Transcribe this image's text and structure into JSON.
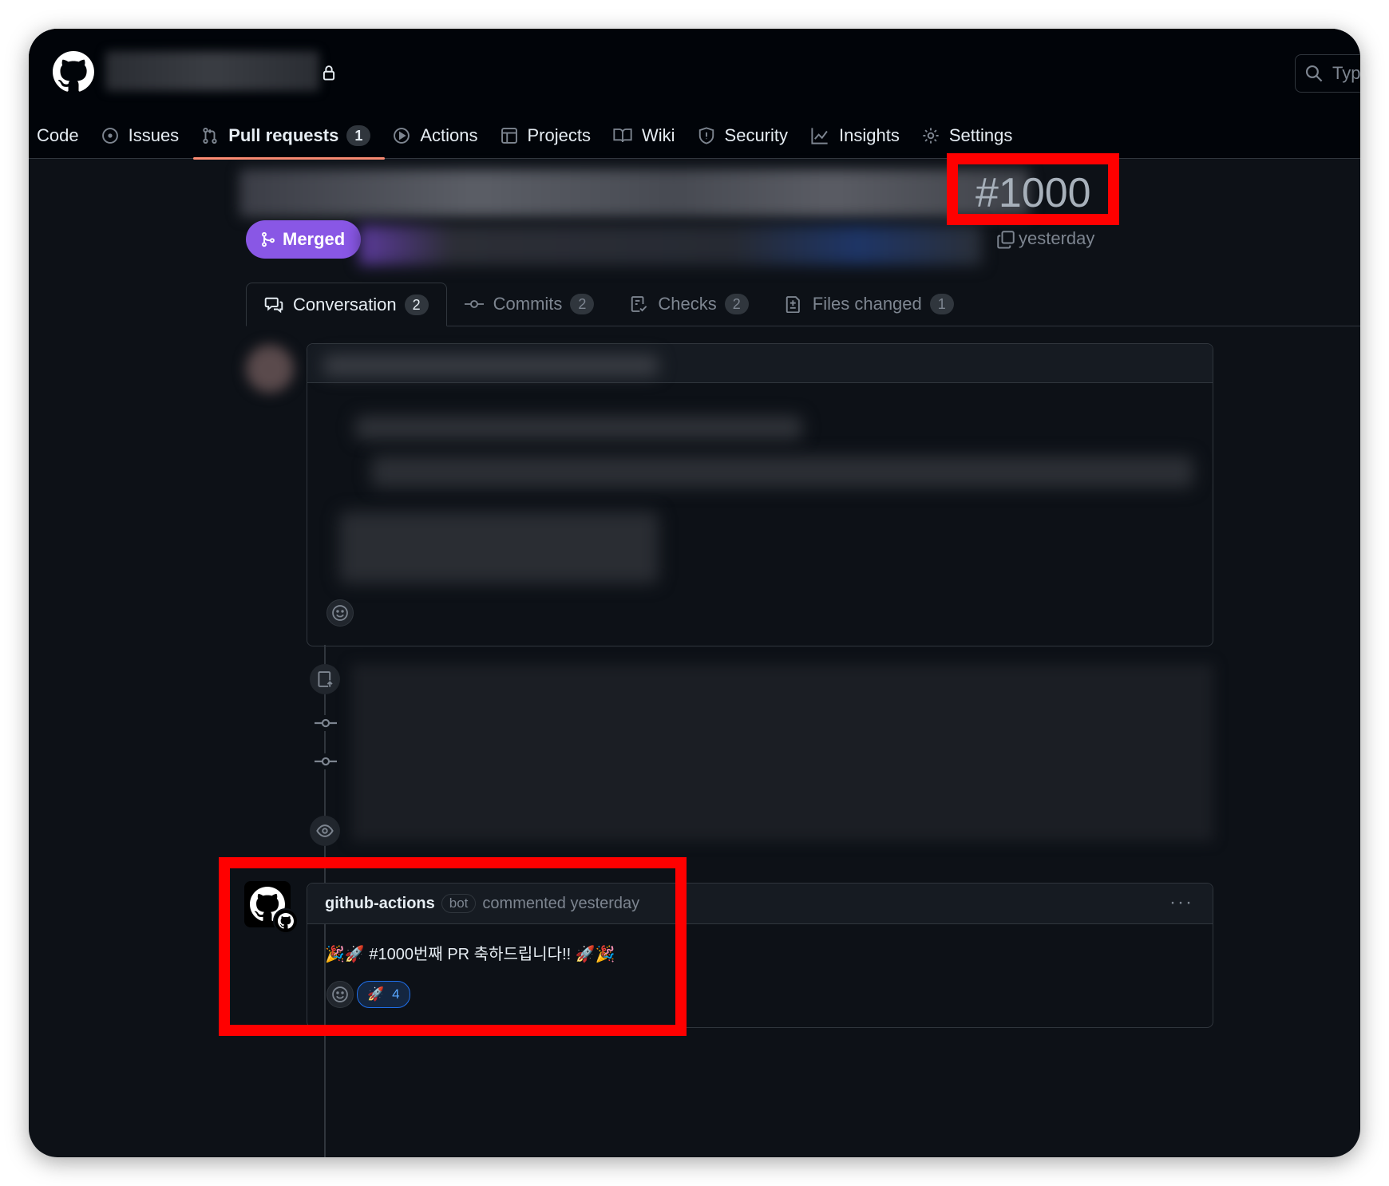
{
  "header": {
    "search_placeholder": "Typ"
  },
  "nav": {
    "items": [
      {
        "label": "Code",
        "icon": "code-icon"
      },
      {
        "label": "Issues",
        "icon": "issue-icon"
      },
      {
        "label": "Pull requests",
        "icon": "pull-request-icon",
        "counter": "1",
        "active": true
      },
      {
        "label": "Actions",
        "icon": "play-icon"
      },
      {
        "label": "Projects",
        "icon": "table-icon"
      },
      {
        "label": "Wiki",
        "icon": "book-icon"
      },
      {
        "label": "Security",
        "icon": "shield-icon"
      },
      {
        "label": "Insights",
        "icon": "graph-icon"
      },
      {
        "label": "Settings",
        "icon": "gear-icon"
      }
    ]
  },
  "pr": {
    "number": "#1000",
    "state": "Merged",
    "time": "yesterday"
  },
  "tabs": [
    {
      "label": "Conversation",
      "count": "2",
      "selected": true
    },
    {
      "label": "Commits",
      "count": "2"
    },
    {
      "label": "Checks",
      "count": "2"
    },
    {
      "label": "Files changed",
      "count": "1"
    }
  ],
  "comment": {
    "author": "github-actions",
    "badge": "bot",
    "action": "commented yesterday",
    "more": "···",
    "body": "🎉🚀 #1000번째 PR 축하드립니다!! 🚀🎉",
    "reaction_emoji": "🚀",
    "reaction_count": "4"
  },
  "colors": {
    "background": "#0d1117",
    "merged": "#8957e5",
    "active_tab_underline": "#fd8c73",
    "highlight": "#ff0000"
  }
}
